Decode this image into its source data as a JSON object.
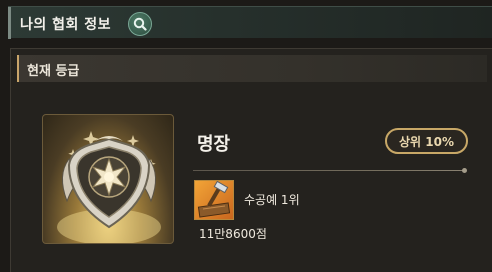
{
  "header": {
    "title": "나의 협회 정보",
    "search_icon": "search-icon"
  },
  "section": {
    "title": "현재 등급"
  },
  "grade": {
    "name": "명장",
    "rank_badge": "상위 10%",
    "emblem_icon": "star-shield-emblem-icon"
  },
  "craft": {
    "icon": "hammer-wood-craft-icon",
    "label": "수공예 1위",
    "score": "11만8600점"
  },
  "colors": {
    "accent_gold": "#c8a867",
    "header_green": "#2d3a35",
    "panel_bg": "#24221e"
  }
}
